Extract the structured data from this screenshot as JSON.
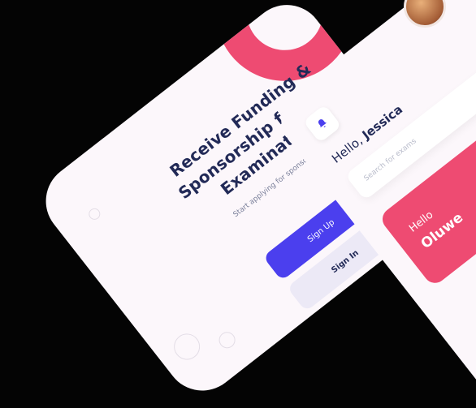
{
  "onboarding": {
    "headline": "Receive Funding &\nSponsorship for any\nExamination",
    "subline": "Start applying for sponsorship now",
    "signup_label": "Sign Up",
    "signin_label": "Sign In"
  },
  "dashboard": {
    "greeting_prefix": "Hello,",
    "greeting_name": "Jessica",
    "search_placeholder": "Search for exams",
    "promo_hello": "Hello",
    "promo_name": "Oluwe"
  },
  "colors": {
    "background": "#040404",
    "accent_pink": "#ee4b72",
    "primary_blue": "#4b3fee",
    "text_dark": "#222a57"
  },
  "icons": [
    "bell-icon",
    "avatar-photo"
  ]
}
